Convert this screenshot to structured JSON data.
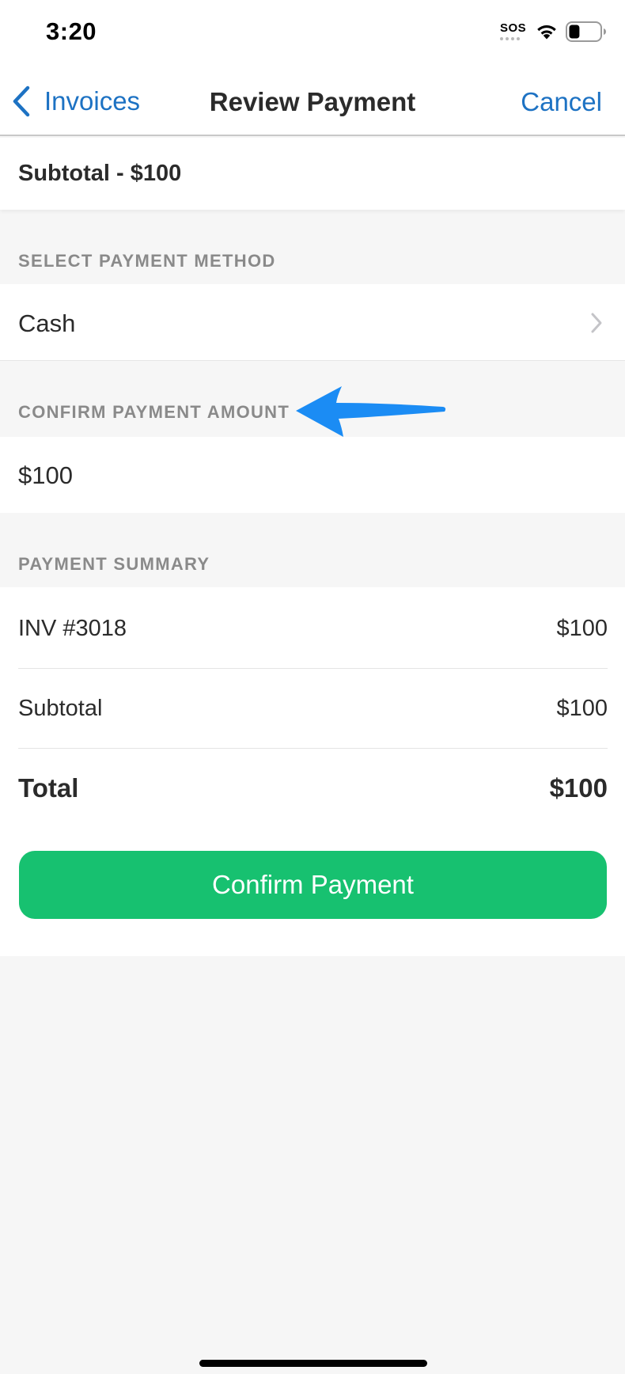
{
  "status_bar": {
    "time": "3:20",
    "sos_label": "SOS",
    "icons": [
      "wifi-icon",
      "battery-icon"
    ],
    "battery_level": 0.35
  },
  "nav": {
    "back_label": "Invoices",
    "back_icon": "chevron-left-icon",
    "title": "Review Payment",
    "cancel_label": "Cancel",
    "accent_color": "#1d72c3"
  },
  "subtotal_header": "Subtotal - $100",
  "payment_method": {
    "section_label": "SELECT PAYMENT METHOD",
    "value": "Cash",
    "icon": "chevron-right-icon"
  },
  "payment_amount": {
    "section_label": "CONFIRM PAYMENT AMOUNT",
    "value": "$100",
    "annotation": "arrow-icon",
    "annotation_color": "#1b8cf4"
  },
  "summary": {
    "section_label": "PAYMENT SUMMARY",
    "rows": [
      {
        "label": "INV #3018",
        "value": "$100"
      },
      {
        "label": "Subtotal",
        "value": "$100"
      }
    ],
    "total": {
      "label": "Total",
      "value": "$100"
    }
  },
  "confirm_button": {
    "label": "Confirm Payment",
    "color": "#17c170"
  }
}
